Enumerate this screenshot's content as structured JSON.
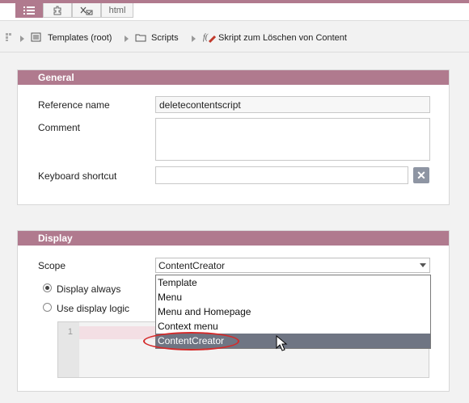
{
  "toolbar": {
    "tabs": [
      {
        "icon": "list-view-icon"
      },
      {
        "icon": "puzzle-icon"
      },
      {
        "icon": "checkbox-x-icon"
      },
      {
        "label": "html"
      }
    ],
    "accent": "#b07a8e"
  },
  "breadcrumb": {
    "items": [
      {
        "label": "Templates (root)",
        "icon": "templates-icon"
      },
      {
        "label": "Scripts",
        "icon": "folder-icon"
      },
      {
        "label": "Skript zum Löschen von Content",
        "icon": "script-icon"
      }
    ]
  },
  "general": {
    "title": "General",
    "reference_label": "Reference name",
    "reference_value": "deletecontentscript",
    "comment_label": "Comment",
    "comment_value": "",
    "shortcut_label": "Keyboard shortcut",
    "shortcut_value": "",
    "clear_glyph": "✕"
  },
  "display": {
    "title": "Display",
    "scope_label": "Scope",
    "scope_value": "ContentCreator",
    "scope_options": [
      "Template",
      "Menu",
      "Menu and Homepage",
      "Context menu",
      "ContentCreator"
    ],
    "radio_always": "Display always",
    "radio_logic": "Use display logic",
    "editor_line": "1"
  }
}
